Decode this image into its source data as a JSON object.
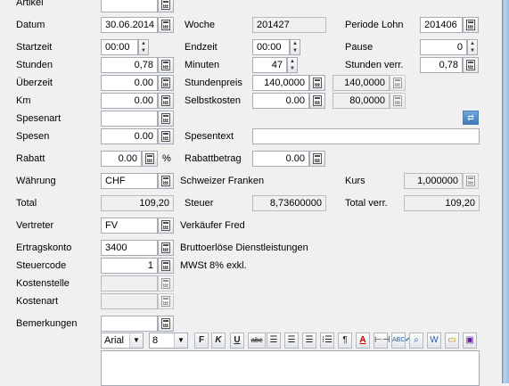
{
  "form": {
    "artikel": {
      "label": "Artikel",
      "value": ""
    },
    "datum": {
      "label": "Datum",
      "value": "30.06.2014"
    },
    "woche": {
      "label": "Woche",
      "value": "201427"
    },
    "periode": {
      "label": "Periode Lohn",
      "value": "201406"
    },
    "startzeit": {
      "label": "Startzeit",
      "value": "00:00"
    },
    "endzeit": {
      "label": "Endzeit",
      "value": "00:00"
    },
    "pause": {
      "label": "Pause",
      "value": "0"
    },
    "stunden": {
      "label": "Stunden",
      "value": "0,78"
    },
    "minuten": {
      "label": "Minuten",
      "value": "47"
    },
    "stunden_verr": {
      "label": "Stunden verr.",
      "value": "0,78"
    },
    "ueberzeit": {
      "label": "Überzeit",
      "value": "0.00"
    },
    "stundenpreis": {
      "label": "Stundenpreis",
      "value": "140,0000",
      "value2": "140,0000"
    },
    "km": {
      "label": "Km",
      "value": "0.00"
    },
    "selbstkosten": {
      "label": "Selbstkosten",
      "value": "0.00",
      "value2": "80,0000"
    },
    "spesenart": {
      "label": "Spesenart",
      "value": ""
    },
    "spesen": {
      "label": "Spesen",
      "value": "0.00"
    },
    "spesentext": {
      "label": "Spesentext",
      "value": ""
    },
    "rabatt": {
      "label": "Rabatt",
      "value": "0.00",
      "unit": "%"
    },
    "rabattbetrag": {
      "label": "Rabattbetrag",
      "value": "0.00"
    },
    "waehrung": {
      "label": "Währung",
      "value": "CHF",
      "desc": "Schweizer Franken"
    },
    "kurs": {
      "label": "Kurs",
      "value": "1,000000"
    },
    "total": {
      "label": "Total",
      "value": "109,20"
    },
    "steuer": {
      "label": "Steuer",
      "value": "8,73600000"
    },
    "total_verr": {
      "label": "Total verr.",
      "value": "109,20"
    },
    "vertreter": {
      "label": "Vertreter",
      "value": "FV",
      "desc": "Verkäufer Fred"
    },
    "ertragskonto": {
      "label": "Ertragskonto",
      "value": "3400",
      "desc": "Bruttoerlöse Dienstleistungen"
    },
    "steuercode": {
      "label": "Steuercode",
      "value": "1",
      "desc": "MWSt 8% exkl."
    },
    "kostenstelle": {
      "label": "Kostenstelle",
      "value": ""
    },
    "kostenart": {
      "label": "Kostenart",
      "value": ""
    },
    "bemerkungen": {
      "label": "Bemerkungen",
      "value": ""
    }
  },
  "editor": {
    "font": "Arial",
    "size": "8",
    "buttons": {
      "bold": "F",
      "italic": "K",
      "underline": "U",
      "strike": "abc",
      "paragraph": "¶",
      "font_color": "A"
    }
  },
  "icons": [
    "calculator-icon",
    "spin-icon",
    "swap-icon",
    "align-left-icon",
    "align-center-icon",
    "align-right-icon",
    "bullet-list-icon",
    "spellcheck-icon",
    "save-icon"
  ]
}
